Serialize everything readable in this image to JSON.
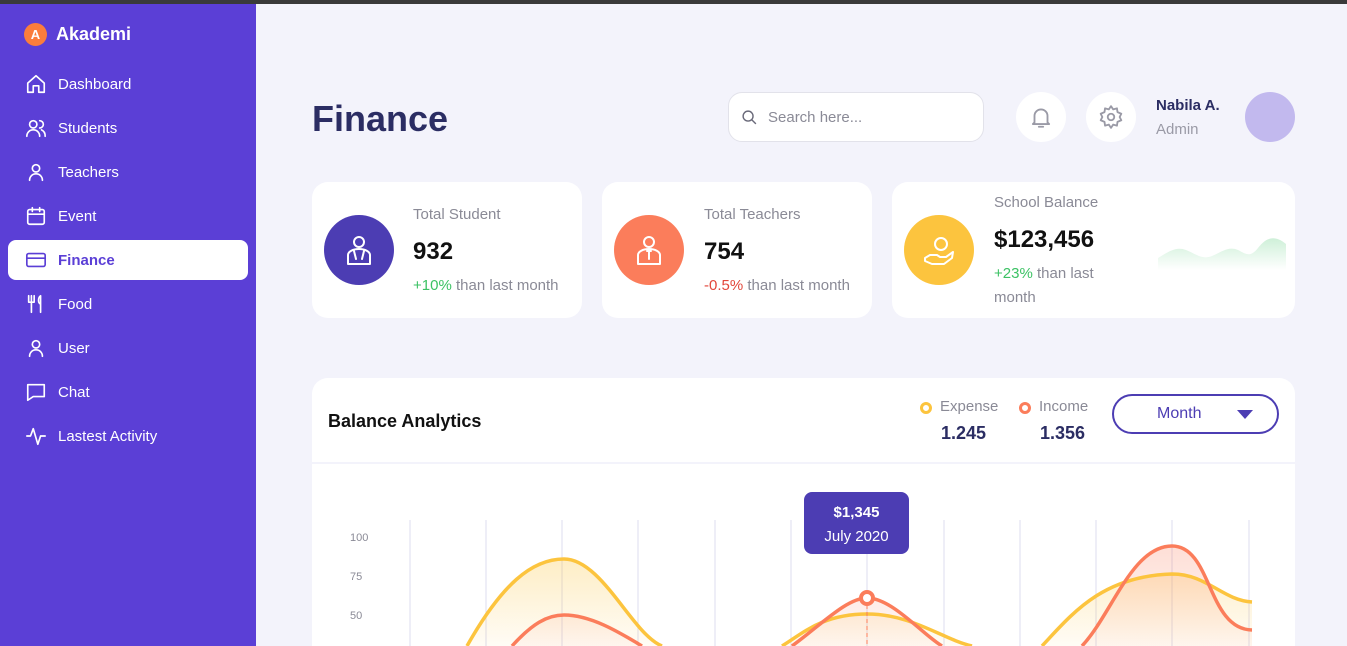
{
  "brand": {
    "logo_letter": "A",
    "name": "Akademi"
  },
  "sidebar": {
    "items": [
      {
        "label": "Dashboard",
        "icon": "home-icon"
      },
      {
        "label": "Students",
        "icon": "users-icon"
      },
      {
        "label": "Teachers",
        "icon": "user-icon"
      },
      {
        "label": "Event",
        "icon": "calendar-icon"
      },
      {
        "label": "Finance",
        "icon": "credit-card-icon",
        "active": true
      },
      {
        "label": "Food",
        "icon": "fork-knife-icon"
      },
      {
        "label": "User",
        "icon": "user-icon"
      },
      {
        "label": "Chat",
        "icon": "chat-icon"
      },
      {
        "label": "Lastest Activity",
        "icon": "activity-icon"
      }
    ]
  },
  "header": {
    "title": "Finance",
    "search_placeholder": "Search here...",
    "user_name": "Nabila A.",
    "user_role": "Admin"
  },
  "stats": [
    {
      "label": "Total Student",
      "value": "932",
      "change": "+10%",
      "change_text": " than last month",
      "trend": "positive",
      "icon": "student-icon",
      "color": "#4c3db3"
    },
    {
      "label": "Total Teachers",
      "value": "754",
      "change": "-0.5%",
      "change_text": " than last month",
      "trend": "negative",
      "icon": "teacher-icon",
      "color": "#fb7d5b"
    },
    {
      "label": "School Balance",
      "value": "$123,456",
      "change": "+23%",
      "change_text": " than last month",
      "trend": "positive",
      "icon": "hand-money-icon",
      "color": "#fcc43e"
    }
  ],
  "analytics": {
    "title": "Balance Analytics",
    "legend": [
      {
        "label": "Expense",
        "value": "1.245",
        "color": "#fcc43e"
      },
      {
        "label": "Income",
        "value": "1.356",
        "color": "#fb7d5b"
      }
    ],
    "period_select": "Month",
    "tooltip": {
      "value": "$1,345",
      "date": "July 2020"
    }
  },
  "chart_data": {
    "type": "area",
    "y_ticks": [
      "100",
      "75",
      "50"
    ],
    "series": [
      {
        "name": "Expense",
        "color": "#fcc43e"
      },
      {
        "name": "Income",
        "color": "#fb7d5b"
      }
    ]
  }
}
